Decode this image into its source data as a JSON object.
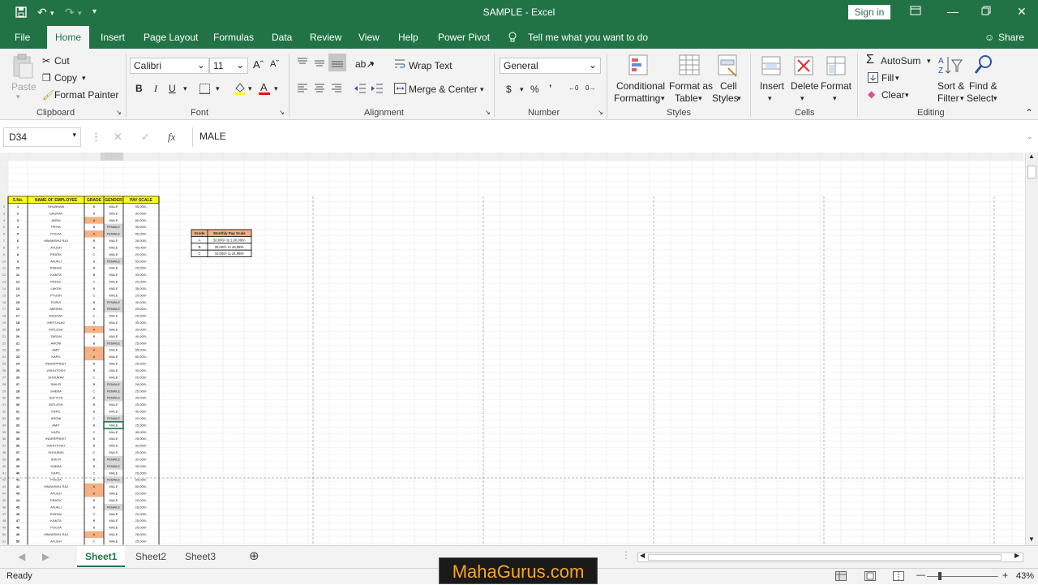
{
  "window": {
    "title": "SAMPLE  -  Excel",
    "signin_label": "Sign in"
  },
  "menu": {
    "file": "File",
    "home": "Home",
    "insert": "Insert",
    "page_layout": "Page Layout",
    "formulas": "Formulas",
    "data": "Data",
    "review": "Review",
    "view": "View",
    "help": "Help",
    "power_pivot": "Power Pivot",
    "tell_me": "Tell me what you want to do",
    "share": "Share"
  },
  "ribbon": {
    "clipboard": {
      "paste": "Paste",
      "cut": "Cut",
      "copy": "Copy",
      "format_painter": "Format Painter",
      "group": "Clipboard"
    },
    "font": {
      "name": "Calibri",
      "size": "11",
      "group": "Font"
    },
    "alignment": {
      "wrap_text": "Wrap Text",
      "merge_center": "Merge & Center",
      "group": "Alignment"
    },
    "number": {
      "format": "General",
      "group": "Number"
    },
    "styles": {
      "conditional_l1": "Conditional",
      "conditional_l2": "Formatting",
      "format_table_l1": "Format as",
      "format_table_l2": "Table",
      "cell_styles_l1": "Cell",
      "cell_styles_l2": "Styles",
      "group": "Styles"
    },
    "cells": {
      "insert": "Insert",
      "delete": "Delete",
      "format": "Format",
      "group": "Cells"
    },
    "editing": {
      "autosum": "AutoSum",
      "fill": "Fill",
      "clear": "Clear",
      "sort_l1": "Sort &",
      "sort_l2": "Filter",
      "find_l1": "Find &",
      "find_l2": "Select",
      "group": "Editing"
    }
  },
  "formula_bar": {
    "name_box": "D34",
    "value": "MALE"
  },
  "sheet": {
    "headers": [
      "S.No.",
      "NAME OF EMPLOYEE",
      "GRADE",
      "GENDER",
      "PAY SCALE"
    ],
    "names": [
      "SHUBHAM",
      "GAURAV",
      "ANSH",
      "PRIYA",
      "POOJA",
      "HIMANSHU RAJ",
      "AYUSH",
      "PRATIK",
      "ANJALI",
      "RISHAV",
      "KAMTA",
      "RAHUL",
      "LAKSH",
      "PYUSH",
      "PURVI",
      "AMISHA",
      "RAGHAV",
      "MRITUNJAI",
      "MITLESH",
      "TARUN",
      "ARONI",
      "AMIT",
      "KAPIL",
      "INDERPREET",
      "ASHUTOSH",
      "SHOURAV",
      "SHILPI",
      "SHENA",
      "SUFIYYA",
      "MITLESH",
      "KAPIL",
      "ARONI",
      "AMIT",
      "KAPIL",
      "INDERPREET",
      "ASHUTOSH",
      "SHOURAV",
      "SHILPI",
      "SHENA",
      "KAPIL",
      "POOJA",
      "HIMANSHU RAJ",
      "AYUSH",
      "PRATIK",
      "ANJALI",
      "RISHAV",
      "KAMTA",
      "POOJA",
      "HIMANSHU RAJ",
      "AYUSH"
    ],
    "grades": [
      "B",
      "B",
      "A",
      "B",
      "A",
      "B",
      "B",
      "C",
      "B",
      "B",
      "B",
      "C",
      "B",
      "C",
      "B",
      "B",
      "C",
      "B",
      "A",
      "B",
      "B",
      "A",
      "A",
      "B",
      "B",
      "C",
      "B",
      "C",
      "B",
      "B",
      "B",
      "C",
      "B",
      "C",
      "B",
      "B",
      "C",
      "B",
      "B",
      "C",
      "B",
      "A",
      "A",
      "B",
      "B",
      "C",
      "B",
      "B",
      "A",
      "C"
    ],
    "genders": [
      "MALE",
      "MALE",
      "MALE",
      "FEMALE",
      "FEMALE",
      "MALE",
      "MALE",
      "MALE",
      "FEMALE",
      "MALE",
      "MALE",
      "MALE",
      "MALE",
      "MALE",
      "FEMALE",
      "FEMALE",
      "MALE",
      "MALE",
      "MALE",
      "MALE",
      "FEMALE",
      "MALE",
      "MALE",
      "MALE",
      "MALE",
      "MALE",
      "FEMALE",
      "FEMALE",
      "FEMALE",
      "MALE",
      "MALE",
      "FEMALE",
      "MALE",
      "MALE",
      "MALE",
      "MALE",
      "MALE",
      "FEMALE",
      "FEMALE",
      "MALE",
      "FEMALE",
      "MALE",
      "MALE",
      "MALE",
      "FEMALE",
      "MALE",
      "MALE",
      "MALE",
      "MALE",
      "MALE"
    ],
    "pays": [
      "55,000/-",
      "30,000/-",
      "80,000/-",
      "35,000/-",
      "55,000/-",
      "28,000/-",
      "40,000/-",
      "20,000/-",
      "55,000/-",
      "25,000/-",
      "35,000/-",
      "20,000/-",
      "35,000/-",
      "20,000/-",
      "40,000/-",
      "25,000/-",
      "20,000/-",
      "35,000/-",
      "30,000/-",
      "40,000/-",
      "25,000/-",
      "55,000/-",
      "80,000/-",
      "25,000/-",
      "30,000/-",
      "20,000/-",
      "28,000/-",
      "25,000/-",
      "30,000/-",
      "25,000/-",
      "40,000/-",
      "20,000/-",
      "25,000/-",
      "40,000/-",
      "25,000/-",
      "30,000/-",
      "25,000/-",
      "30,000/-",
      "35,000/-",
      "20,000/-",
      "55,000/-",
      "80,000/-",
      "25,000/-",
      "20,000/-",
      "28,000/-",
      "20,000/-",
      "25,000/-",
      "20,000/-",
      "28,000/-",
      "25,000/-"
    ],
    "grade_table": {
      "headers": [
        "Grade",
        "Monthly Pay Scale"
      ],
      "rows": [
        [
          "A",
          "50,000/- to 1,00,000/-"
        ],
        [
          "B",
          "25,000/- to 49,999/-"
        ],
        [
          "C",
          "10,000/- to 24,999/-"
        ]
      ]
    }
  },
  "sheet_tabs": [
    "Sheet1",
    "Sheet2",
    "Sheet3"
  ],
  "status": {
    "ready": "Ready",
    "zoom": "43%"
  },
  "watermark": "MahaGurus.com",
  "colors": {
    "excel_green": "#217346",
    "grade_a_fill": "#f4b183",
    "female_fill": "#d9d9d9",
    "header_fill": "#ffff00"
  }
}
